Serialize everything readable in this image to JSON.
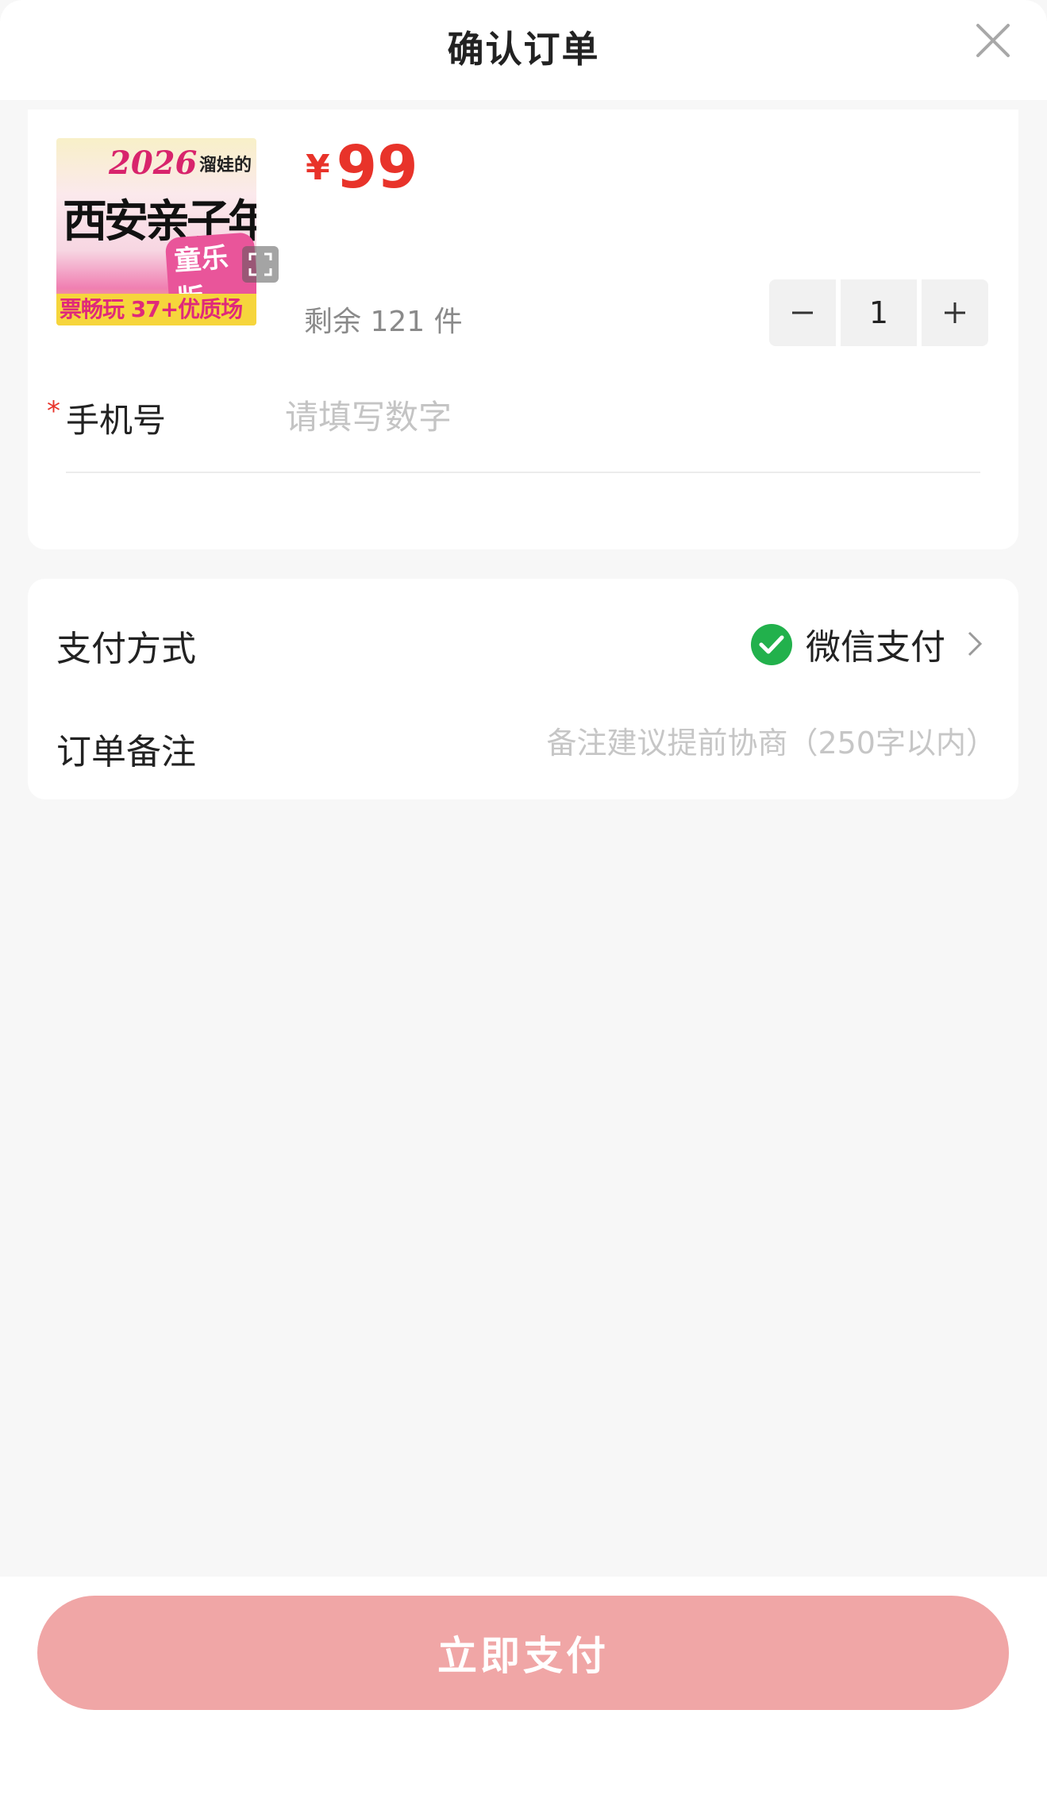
{
  "header": {
    "title": "确认订单",
    "close_icon": "close-icon"
  },
  "product": {
    "thumbnail": {
      "year": "2026",
      "tag": "溜娃的",
      "title": "西安亲子年",
      "edition": "童乐版",
      "strip": "票畅玩 37+优质场"
    },
    "price_symbol": "¥",
    "price": "99",
    "stock": "剩余 121 件",
    "quantity": "1",
    "minus_icon": "minus-icon",
    "plus_icon": "plus-icon"
  },
  "form": {
    "phone": {
      "required_mark": "*",
      "label": "手机号",
      "placeholder": "请填写数字",
      "value": ""
    }
  },
  "payment": {
    "method_label": "支付方式",
    "method_value": "微信支付",
    "method_icon": "wechat-pay-icon",
    "remark_label": "订单备注",
    "remark_placeholder": "备注建议提前协商（250字以内）"
  },
  "footer": {
    "pay_button": "立即支付"
  },
  "colors": {
    "price": "#e8332a",
    "button": "#f0a6a6",
    "wechat": "#22b14c",
    "background": "#f7f7f7"
  }
}
